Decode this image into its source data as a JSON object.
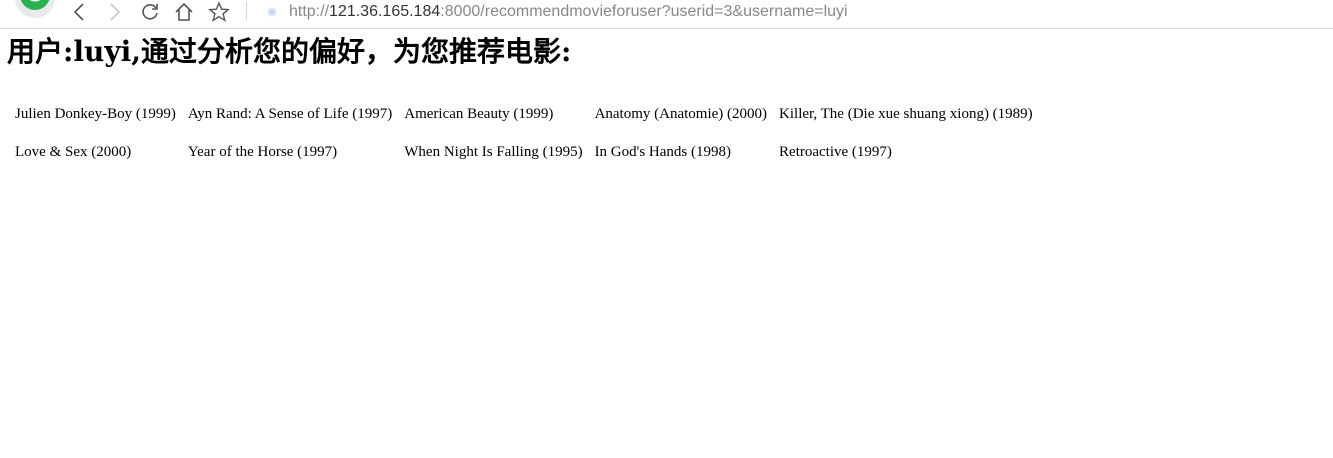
{
  "browser": {
    "url_scheme": "http://",
    "url_host": "121.36.165.184",
    "url_rest": ":8000/recommendmovieforuser?userid=3&username=luyi",
    "accent_color": "#2bb24c"
  },
  "page": {
    "title_prefix": "用户",
    "title_sep1": ":",
    "username": "luyi",
    "title_sep2": ",",
    "title_suffix": "通过分析您的偏好，为您推荐电影:"
  },
  "movies": {
    "rows": [
      [
        "Julien Donkey-Boy (1999)",
        "Ayn Rand: A Sense of Life (1997)",
        "American Beauty (1999)",
        "Anatomy (Anatomie) (2000)",
        "Killer, The (Die xue shuang xiong) (1989)"
      ],
      [
        "Love & Sex (2000)",
        "Year of the Horse (1997)",
        "When Night Is Falling (1995)",
        "In God's Hands (1998)",
        "Retroactive (1997)"
      ]
    ]
  }
}
